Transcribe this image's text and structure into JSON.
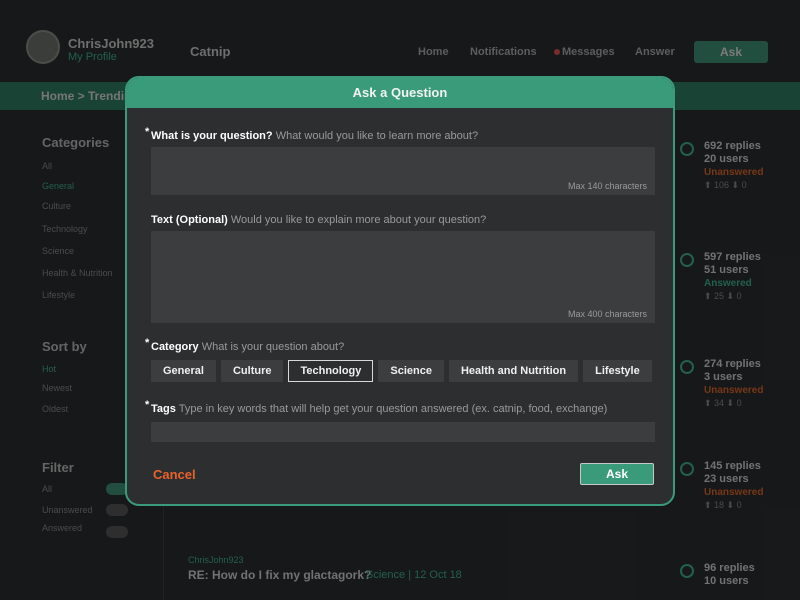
{
  "header": {
    "username": "ChrisJohn923",
    "my_profile": "My Profile",
    "brand": "Catnip",
    "nav": [
      "Home",
      "Notifications",
      "Messages",
      "Answer"
    ],
    "ask_label": "Ask"
  },
  "breadcrumb": "Home > Trending",
  "sidebar": {
    "categories_title": "Categories",
    "categories": [
      "All",
      "General",
      "Culture",
      "Technology",
      "Science",
      "Health & Nutrition",
      "Lifestyle"
    ],
    "sort_title": "Sort by",
    "sort": [
      "Hot",
      "Newest",
      "Oldest"
    ],
    "filter_title": "Filter",
    "filters": [
      "All",
      "Unanswered",
      "Answered"
    ]
  },
  "feed": {
    "stats": [
      {
        "replies": "692 replies",
        "users": "20 users",
        "status": "Unanswered",
        "votes": "⬆ 106  ⬇ 0"
      },
      {
        "replies": "597 replies",
        "users": "51 users",
        "status": "Answered",
        "votes": "⬆ 25  ⬇ 0"
      },
      {
        "replies": "274 replies",
        "users": "3 users",
        "status": "Unanswered",
        "votes": "⬆ 34  ⬇ 0"
      },
      {
        "replies": "145 replies",
        "users": "23 users",
        "status": "Unanswered",
        "votes": "⬆ 18  ⬇ 0"
      },
      {
        "replies": "96 replies",
        "users": "10 users",
        "status": "",
        "votes": ""
      }
    ],
    "last_title": "RE: How do I fix my glactagork?",
    "last_category": "Science | 12 Oct 18",
    "last_meta": "ChrisJohn923"
  },
  "modal": {
    "title": "Ask a Question",
    "question_label": "What is your question?",
    "question_hint": "What would you like to learn more about?",
    "question_max": "Max 140 characters",
    "text_label": "Text (Optional)",
    "text_hint": "Would you like to explain more about your question?",
    "text_max": "Max 400 characters",
    "category_label": "Category",
    "category_hint": "What is your question about?",
    "categories": [
      "General",
      "Culture",
      "Technology",
      "Science",
      "Health and Nutrition",
      "Lifestyle"
    ],
    "selected_category": "Technology",
    "tags_label": "Tags",
    "tags_hint": "Type in key words that will help get your question answered (ex. catnip, food, exchange)",
    "required_mark": "*",
    "cancel_label": "Cancel",
    "ask_label": "Ask"
  },
  "colors": {
    "accent": "#3a9b7b",
    "cancel": "#e8622a",
    "panel": "#2c2e30",
    "input": "#3b3d3f"
  }
}
